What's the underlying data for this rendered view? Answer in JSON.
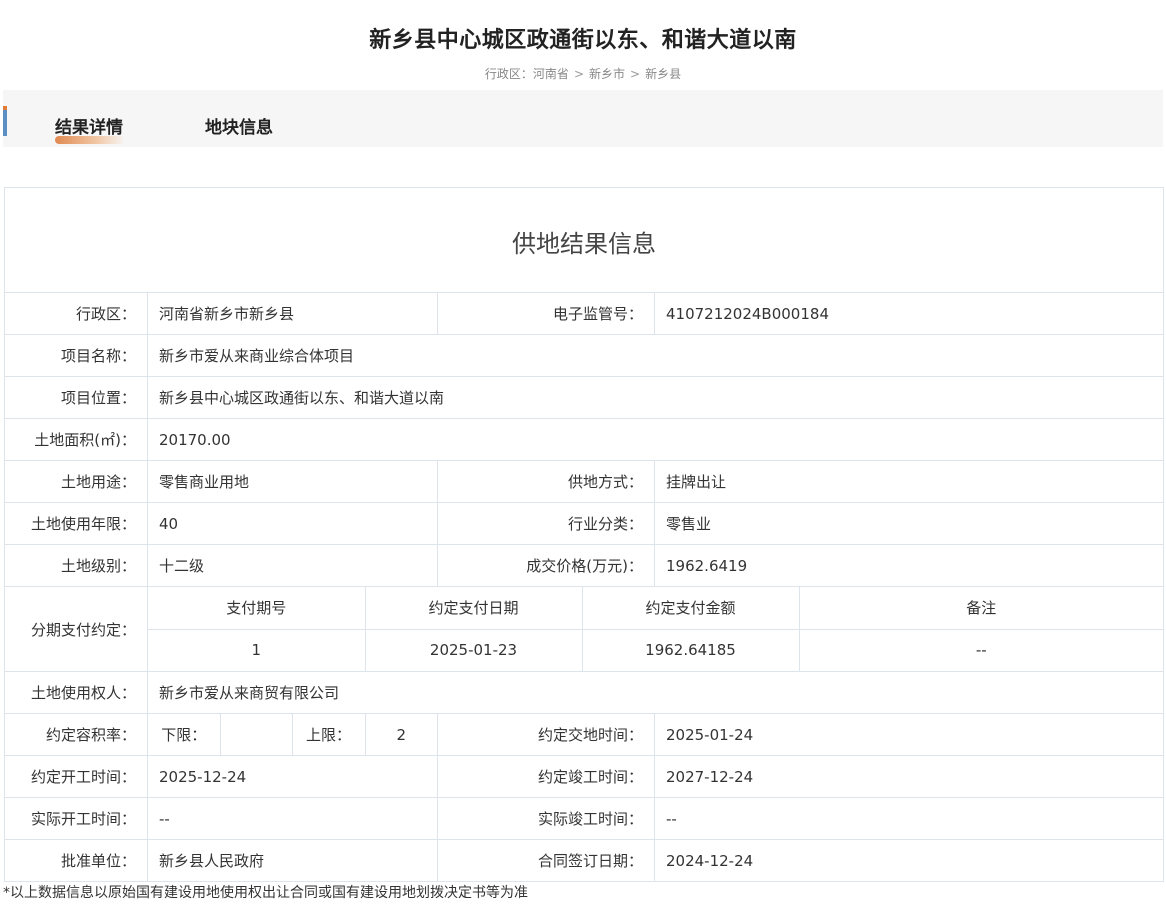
{
  "header": {
    "title": "新乡县中心城区政通街以东、和谐大道以南",
    "breadcrumb": {
      "prefix": "行政区：",
      "items": [
        "河南省",
        "新乡市",
        "新乡县"
      ],
      "separator": ">"
    }
  },
  "tabs": [
    {
      "label": "结果详情",
      "active": true
    },
    {
      "label": "地块信息",
      "active": false
    }
  ],
  "colors": {
    "accent_blue": "#5b8ec2",
    "accent_orange": "#e07b39",
    "border": "#dde4ec"
  },
  "result": {
    "section_title": "供地结果信息",
    "admin_region": {
      "label": "行政区：",
      "value": "河南省新乡市新乡县"
    },
    "supervision_no": {
      "label": "电子监管号：",
      "value": "4107212024B000184"
    },
    "project_name": {
      "label": "项目名称：",
      "value": "新乡市爱从来商业综合体项目"
    },
    "project_location": {
      "label": "项目位置：",
      "value": "新乡县中心城区政通街以东、和谐大道以南"
    },
    "land_area": {
      "label": "土地面积(㎡)：",
      "value": "20170.00"
    },
    "land_use": {
      "label": "土地用途：",
      "value": "零售商业用地"
    },
    "supply_method": {
      "label": "供地方式：",
      "value": "挂牌出让"
    },
    "use_term": {
      "label": "土地使用年限：",
      "value": "40"
    },
    "industry": {
      "label": "行业分类：",
      "value": "零售业"
    },
    "land_grade": {
      "label": "土地级别：",
      "value": "十二级"
    },
    "deal_price": {
      "label": "成交价格(万元)：",
      "value": "1962.6419"
    },
    "installments": {
      "label": "分期支付约定：",
      "headers": [
        "支付期号",
        "约定支付日期",
        "约定支付金额",
        "备注"
      ],
      "rows": [
        [
          "1",
          "2025-01-23",
          "1962.64185",
          "--"
        ]
      ]
    },
    "land_user": {
      "label": "土地使用权人：",
      "value": "新乡市爱从来商贸有限公司"
    },
    "far": {
      "label": "约定容积率：",
      "lower_label": "下限：",
      "lower_value": "",
      "upper_label": "上限：",
      "upper_value": "2"
    },
    "handover_date": {
      "label": "约定交地时间：",
      "value": "2025-01-24"
    },
    "start_date": {
      "label": "约定开工时间：",
      "value": "2025-12-24"
    },
    "finish_date": {
      "label": "约定竣工时间：",
      "value": "2027-12-24"
    },
    "actual_start": {
      "label": "实际开工时间：",
      "value": "--"
    },
    "actual_finish": {
      "label": "实际竣工时间：",
      "value": "--"
    },
    "approver": {
      "label": "批准单位：",
      "value": "新乡县人民政府"
    },
    "contract_date": {
      "label": "合同签订日期：",
      "value": "2024-12-24"
    }
  },
  "footnote": "*以上数据信息以原始国有建设用地使用权出让合同或国有建设用地划拨决定书等为准"
}
